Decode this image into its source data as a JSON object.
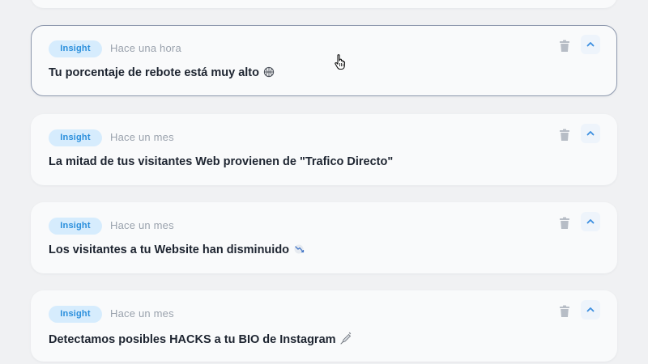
{
  "cards": [
    {
      "badge": "Insight",
      "time": "Hace una hora",
      "title": "Tu porcentaje de rebote está muy alto"
    },
    {
      "badge": "Insight",
      "time": "Hace un mes",
      "title": "La mitad de tus visitantes Web provienen de \"Trafico Directo\""
    },
    {
      "badge": "Insight",
      "time": "Hace un mes",
      "title": "Los visitantes a tu Website han disminuido"
    },
    {
      "badge": "Insight",
      "time": "Hace un mes",
      "title": "Detectamos posibles HACKS a tu BIO de Instagram"
    }
  ],
  "icons": {
    "delete": "trash-icon",
    "collapse": "chevron-up-icon",
    "cursor": "hand-pointer-icon"
  },
  "colors": {
    "badge_bg": "#d6ecfd",
    "badge_text": "#2a8fdc",
    "active_border": "#8d98ad",
    "page_bg": "#f0f1f3",
    "card_bg": "#f9fafb"
  }
}
